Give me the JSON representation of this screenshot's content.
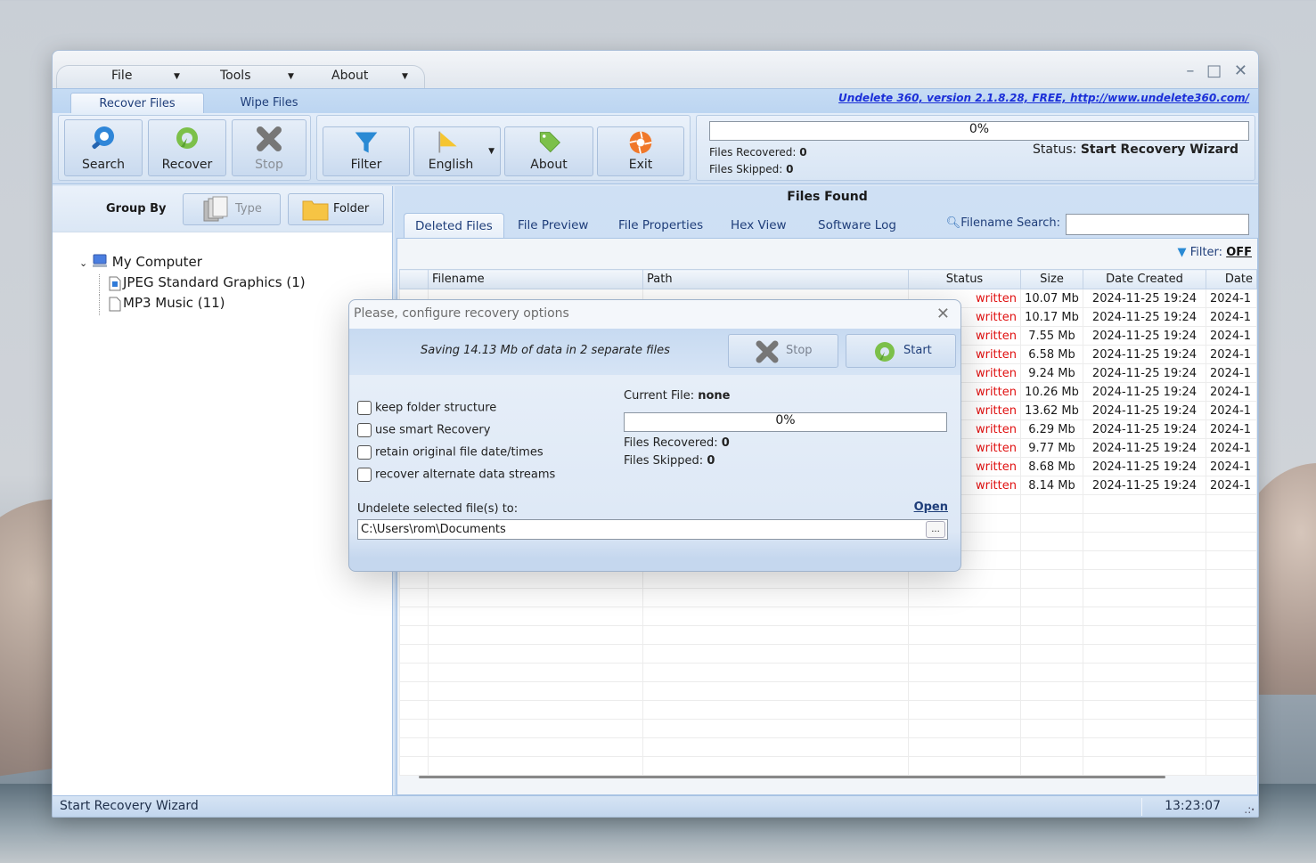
{
  "window": {
    "menu": [
      {
        "label": "File",
        "accel": "F"
      },
      {
        "label": "Tools",
        "accel": "T"
      },
      {
        "label": "About",
        "accel": "A"
      }
    ],
    "controls": {
      "minimize": "–",
      "maximize": "□",
      "close": "✕"
    },
    "version_link": "Undelete 360, version 2.1.8.28, FREE, http://www.undelete360.com/"
  },
  "ribbon_tabs": [
    {
      "label": "Recover Files",
      "active": true
    },
    {
      "label": "Wipe Files",
      "active": false
    }
  ],
  "ribbon": {
    "buttons": [
      {
        "label": "Search",
        "icon": "search-icon",
        "enabled": true
      },
      {
        "label": "Recover",
        "icon": "recover-icon",
        "enabled": true
      },
      {
        "label": "Stop",
        "icon": "stop-icon",
        "enabled": false
      },
      {
        "label": "Filter",
        "icon": "filter-icon",
        "enabled": true
      },
      {
        "label": "English",
        "icon": "flag-icon",
        "enabled": true,
        "dropdown": true
      },
      {
        "label": "About",
        "icon": "tag-icon",
        "enabled": true
      },
      {
        "label": "Exit",
        "icon": "exit-icon",
        "enabled": true
      }
    ],
    "progress": {
      "percent": 0,
      "text": "0%"
    },
    "files_recovered_label": "Files Recovered:",
    "files_recovered": "0",
    "files_skipped_label": "Files Skipped:",
    "files_skipped": "0",
    "status_label": "Status:",
    "status_value": "Start Recovery Wizard"
  },
  "left_pane": {
    "group_by_label": "Group By",
    "group_buttons": [
      {
        "label": "Type",
        "enabled": false
      },
      {
        "label": "Folder",
        "enabled": true
      }
    ],
    "tree": {
      "root": "My Computer",
      "children": [
        {
          "label": "JPEG Standard Graphics (1)",
          "icon": "image-file-icon"
        },
        {
          "label": "MP3 Music (11)",
          "icon": "file-icon"
        }
      ]
    }
  },
  "right_pane": {
    "title": "Files Found",
    "tabs": [
      {
        "label": "Deleted Files",
        "active": true
      },
      {
        "label": "File Preview"
      },
      {
        "label": "File Properties"
      },
      {
        "label": "Hex View"
      },
      {
        "label": "Software Log"
      }
    ],
    "search_label": "Filename Search:",
    "search_value": "",
    "filter_label": "Filter:",
    "filter_value": "OFF",
    "columns": [
      "",
      "Filename",
      "Path",
      "Status",
      "Size",
      "Date Created",
      "Date"
    ],
    "rows": [
      {
        "status": "written",
        "size": "10.07 Mb",
        "created": "2024-11-25 19:24",
        "date": "2024-1"
      },
      {
        "status": "written",
        "size": "10.17 Mb",
        "created": "2024-11-25 19:24",
        "date": "2024-1"
      },
      {
        "status": "written",
        "size": "7.55 Mb",
        "created": "2024-11-25 19:24",
        "date": "2024-1"
      },
      {
        "status": "written",
        "size": "6.58 Mb",
        "created": "2024-11-25 19:24",
        "date": "2024-1"
      },
      {
        "status": "written",
        "size": "9.24 Mb",
        "created": "2024-11-25 19:24",
        "date": "2024-1"
      },
      {
        "status": "written",
        "size": "10.26 Mb",
        "created": "2024-11-25 19:24",
        "date": "2024-1"
      },
      {
        "status": "written",
        "size": "13.62 Mb",
        "created": "2024-11-25 19:24",
        "date": "2024-1"
      },
      {
        "status": "written",
        "size": "6.29 Mb",
        "created": "2024-11-25 19:24",
        "date": "2024-1"
      },
      {
        "status": "written",
        "size": "9.77 Mb",
        "created": "2024-11-25 19:24",
        "date": "2024-1"
      },
      {
        "status": "written",
        "size": "8.68 Mb",
        "created": "2024-11-25 19:24",
        "date": "2024-1"
      },
      {
        "status": "written",
        "size": "8.14 Mb",
        "created": "2024-11-25 19:24",
        "date": "2024-1"
      }
    ],
    "status_color": "#e01010"
  },
  "dialog": {
    "title": "Please, configure recovery options",
    "saving_text": "Saving 14.13 Mb of data in 2 separate files",
    "stop_label": "Stop",
    "start_label": "Start",
    "options": [
      {
        "label": "keep folder structure",
        "checked": false
      },
      {
        "label": "use smart Recovery",
        "checked": false
      },
      {
        "label": "retain original file date/times",
        "checked": false
      },
      {
        "label": "recover alternate data streams",
        "checked": false
      }
    ],
    "current_file_label": "Current File:",
    "current_file_value": "none",
    "progress": {
      "percent": 0,
      "text": "0%"
    },
    "files_recovered_label": "Files Recovered:",
    "files_recovered": "0",
    "files_skipped_label": "Files Skipped:",
    "files_skipped": "0",
    "dest_label": "Undelete selected file(s) to:",
    "open_link": "Open",
    "dest_path": "C:\\Users\\rom\\Documents",
    "browse_label": "..."
  },
  "statusbar": {
    "message": "Start Recovery Wizard",
    "time": "13:23:07"
  }
}
